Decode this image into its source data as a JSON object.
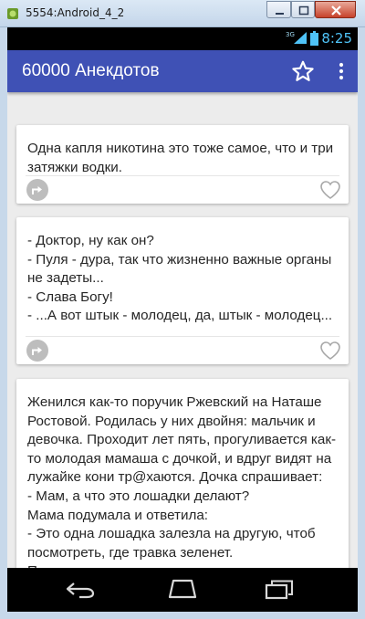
{
  "window": {
    "title": "5554:Android_4_2"
  },
  "statusbar": {
    "time": "8:25",
    "network": "3G"
  },
  "appbar": {
    "title": "60000 Анекдотов"
  },
  "jokes": [
    {
      "text": "Одна капля никотина это тоже самое, что и три затяжки водки."
    },
    {
      "text": "- Доктор, ну как он?\n- Пуля - дура, так что жизненно важные органы не задеты...\n- Слава Богу!\n- ...А вот штык - молодец, да, штык - молодец..."
    },
    {
      "text": "Женился как-то поручик Ржевский на Наташе Ростовой. Родилась у них двойня: мальчик и девочка. Проходит лет пять, прогуливается как-то молодая мамаша с дочкой, и вдруг видят на лужайке кони тр@хаются. Дочка спрашивает:\n- Мам, а что это лошадки делают?\nМама подумала и ответила:\n- Это одна лошадка залезла на другую, чтоб посмотреть, где травка зеленет.\nПроходит какое-то время, прогуливается сестра с братом, и видят снова коней в этой позе."
    }
  ],
  "icons": {
    "window": "android-app-icon",
    "favorite": "star-outline-icon",
    "overflow": "more-vertical-icon",
    "share": "share-icon",
    "like": "heart-outline-icon",
    "back": "back-icon",
    "home": "home-icon",
    "recent": "recent-apps-icon"
  },
  "colors": {
    "appbar": "#3f51b5",
    "status_time": "#4fc3f7",
    "card_background": "#ffffff",
    "feed_background": "#ececec"
  }
}
